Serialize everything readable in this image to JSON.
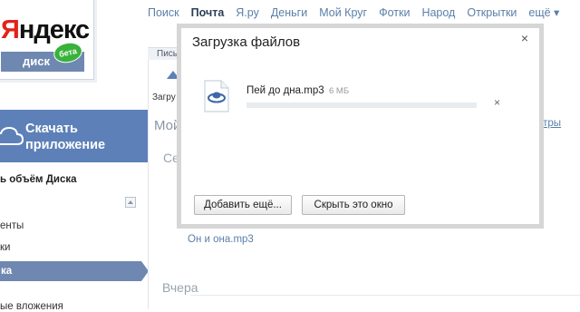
{
  "topnav": {
    "items": [
      {
        "label": "Поиск",
        "active": false
      },
      {
        "label": "Почта",
        "active": true
      },
      {
        "label": "Я.ру",
        "active": false
      },
      {
        "label": "Деньги",
        "active": false
      },
      {
        "label": "Мой Круг",
        "active": false
      },
      {
        "label": "Фотки",
        "active": false
      },
      {
        "label": "Народ",
        "active": false
      },
      {
        "label": "Открытки",
        "active": false
      },
      {
        "label": "ещё ▾",
        "active": false
      }
    ]
  },
  "logo": {
    "first_letter": "Я",
    "rest": "ндекс",
    "sublabel": "диск",
    "badge": "бета"
  },
  "sidebar": {
    "download_app_label": "Скачать приложение",
    "quota_label": "ь объём Диска",
    "items": [
      {
        "label": "енты"
      },
      {
        "label": "ки"
      },
      {
        "label": "ка",
        "active": true
      },
      {
        "label": "ые вложения"
      }
    ]
  },
  "main": {
    "tab_partial": "Пись",
    "upload_label": "Загру",
    "title_partial": "Мой",
    "filter_partial": "ьтры",
    "today_partial": "Се",
    "file_link": "Он и она.mp3",
    "yesterday_label": "Вчера"
  },
  "modal": {
    "title": "Загрузка файлов",
    "close_glyph": "×",
    "file": {
      "name": "Пей до дна.mp3",
      "size": "6 МБ",
      "progress": 0,
      "cancel_glyph": "×"
    },
    "buttons": {
      "add_more": "Добавить ещё...",
      "hide": "Скрыть это окно"
    }
  },
  "colors": {
    "accent": "#5d80b8",
    "link": "#5a7fa8",
    "logo_red": "#e2231a",
    "badge_green": "#38b23a"
  }
}
